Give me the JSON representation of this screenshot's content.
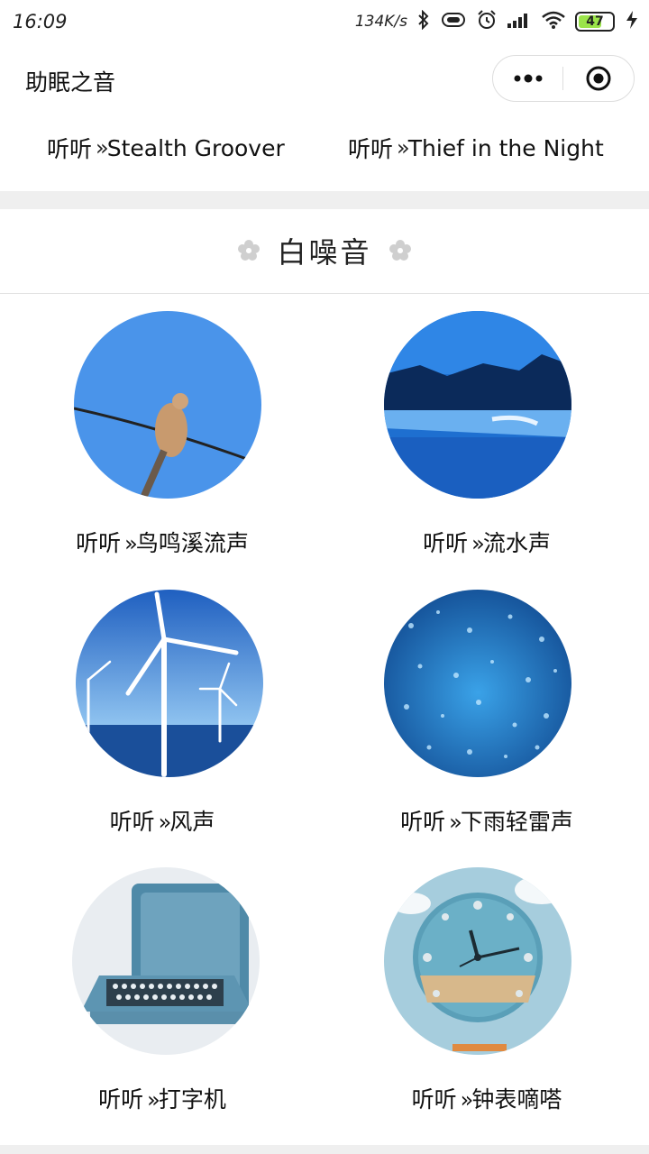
{
  "status_bar": {
    "time": "16:09",
    "speed": "134K/s",
    "battery": "47"
  },
  "nav": {
    "title": "助眠之音"
  },
  "top_links": [
    {
      "prefix": "听听",
      "chevron": "»",
      "title": "Stealth Groover"
    },
    {
      "prefix": "听听",
      "chevron": "»",
      "title": "Thief in the Night"
    }
  ],
  "section": {
    "title": "白噪音"
  },
  "items": [
    {
      "prefix": "听听",
      "chevron": "»",
      "title": "鸟鸣溪流声",
      "image": "bird-on-wire"
    },
    {
      "prefix": "听听",
      "chevron": "»",
      "title": "流水声",
      "image": "blue-painting"
    },
    {
      "prefix": "听听",
      "chevron": "»",
      "title": "风声",
      "image": "wind-turbines"
    },
    {
      "prefix": "听听",
      "chevron": "»",
      "title": "下雨轻雷声",
      "image": "raindrops"
    },
    {
      "prefix": "听听",
      "chevron": "»",
      "title": "打字机",
      "image": "typewriter"
    },
    {
      "prefix": "听听",
      "chevron": "»",
      "title": "钟表嘀嗒",
      "image": "wall-clock"
    }
  ],
  "colors": {
    "separator": "#efefef",
    "sky": "#4a90e2",
    "deep_blue": "#1557a8"
  }
}
